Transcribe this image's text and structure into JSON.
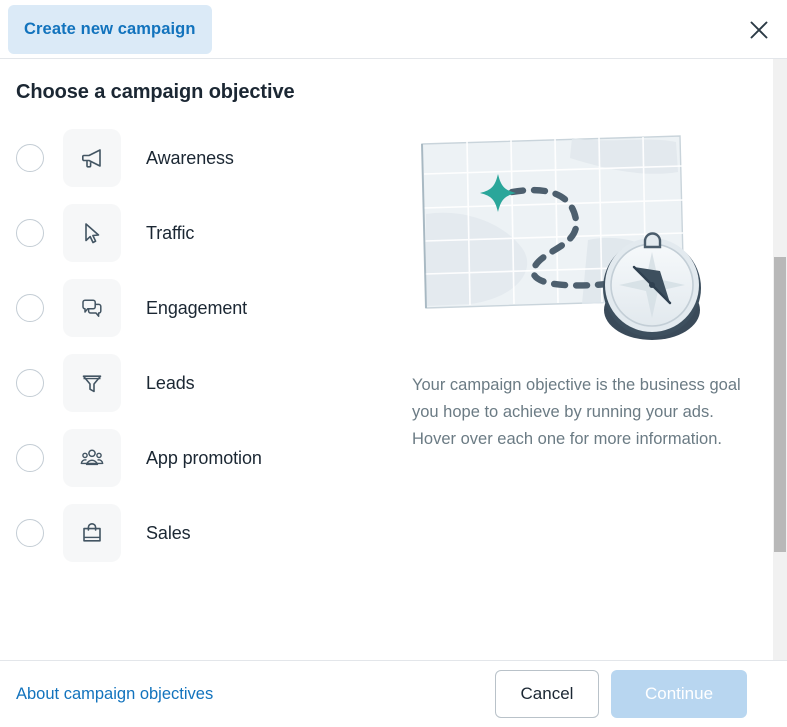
{
  "header": {
    "tab_label": "Create new campaign",
    "close_icon": "close-icon"
  },
  "main": {
    "title": "Choose a campaign objective",
    "objectives": [
      {
        "label": "Awareness",
        "icon": "megaphone-icon",
        "selected": false
      },
      {
        "label": "Traffic",
        "icon": "cursor-arrow-icon",
        "selected": false
      },
      {
        "label": "Engagement",
        "icon": "chat-bubbles-icon",
        "selected": false
      },
      {
        "label": "Leads",
        "icon": "funnel-icon",
        "selected": false
      },
      {
        "label": "App promotion",
        "icon": "people-group-icon",
        "selected": false
      },
      {
        "label": "Sales",
        "icon": "shopping-bag-icon",
        "selected": false
      }
    ],
    "illustration": {
      "name": "map-with-compass-illustration",
      "elements": [
        "map-grid",
        "dashed-route",
        "star-marker",
        "compass"
      ]
    },
    "description": "Your campaign objective is the business goal you hope to achieve by running your ads. Hover over each one for more information."
  },
  "footer": {
    "link_label": "About campaign objectives",
    "cancel_label": "Cancel",
    "continue_label": "Continue",
    "continue_disabled": true
  },
  "colors": {
    "accent_blue": "#1273bd",
    "tab_background": "#dbeaf7",
    "text_primary": "#1b2733",
    "text_muted": "#6b7b84",
    "icon_tile": "#f6f7f8",
    "star_teal": "#2aa69a",
    "continue_disabled": "#b8d6f0"
  },
  "scrollbar": {
    "thumb_top_pct": 33,
    "thumb_height_pct": 49
  }
}
